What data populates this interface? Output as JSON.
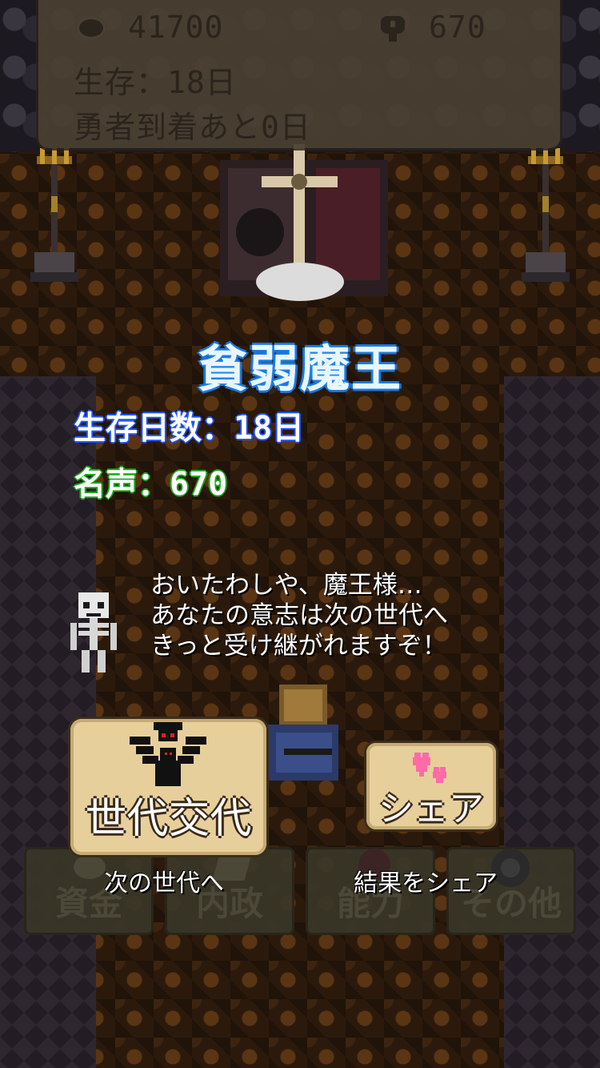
{
  "stats": {
    "coin_icon": "coin-icon",
    "coins": "41700",
    "fame_icon": "fame-icon",
    "fame": "670",
    "survival": "生存：18日",
    "hero_arrival": "勇者到着あと0日"
  },
  "result": {
    "title": "貧弱魔王",
    "days_survived": "生存日数：18日",
    "fame": "名声：670"
  },
  "dialog": {
    "speaker_icon": "skeleton-icon",
    "lines": [
      "おいたわしや、魔王様…",
      "あなたの意志は次の世代へ",
      "きっと受け継がれますぞ！"
    ]
  },
  "actions": {
    "next_generation": {
      "label": "世代交代",
      "caption": "次の世代へ",
      "icon": "demon-silhouette-icon"
    },
    "share": {
      "label": "シェア",
      "caption": "結果をシェア",
      "icon": "hearts-icon"
    }
  },
  "menu": {
    "items": [
      {
        "label": "資金",
        "icon": "coin-icon"
      },
      {
        "label": "内政",
        "icon": "pickaxe-icon"
      },
      {
        "label": "能力",
        "icon": "skill-icon"
      },
      {
        "label": "その他",
        "icon": "gear-icon"
      }
    ]
  },
  "colors": {
    "title_outline": "#1a6fd6",
    "days_outline": "#2255ff",
    "fame_outline": "#1fa81f",
    "button_fill": "#e7cf9c"
  }
}
